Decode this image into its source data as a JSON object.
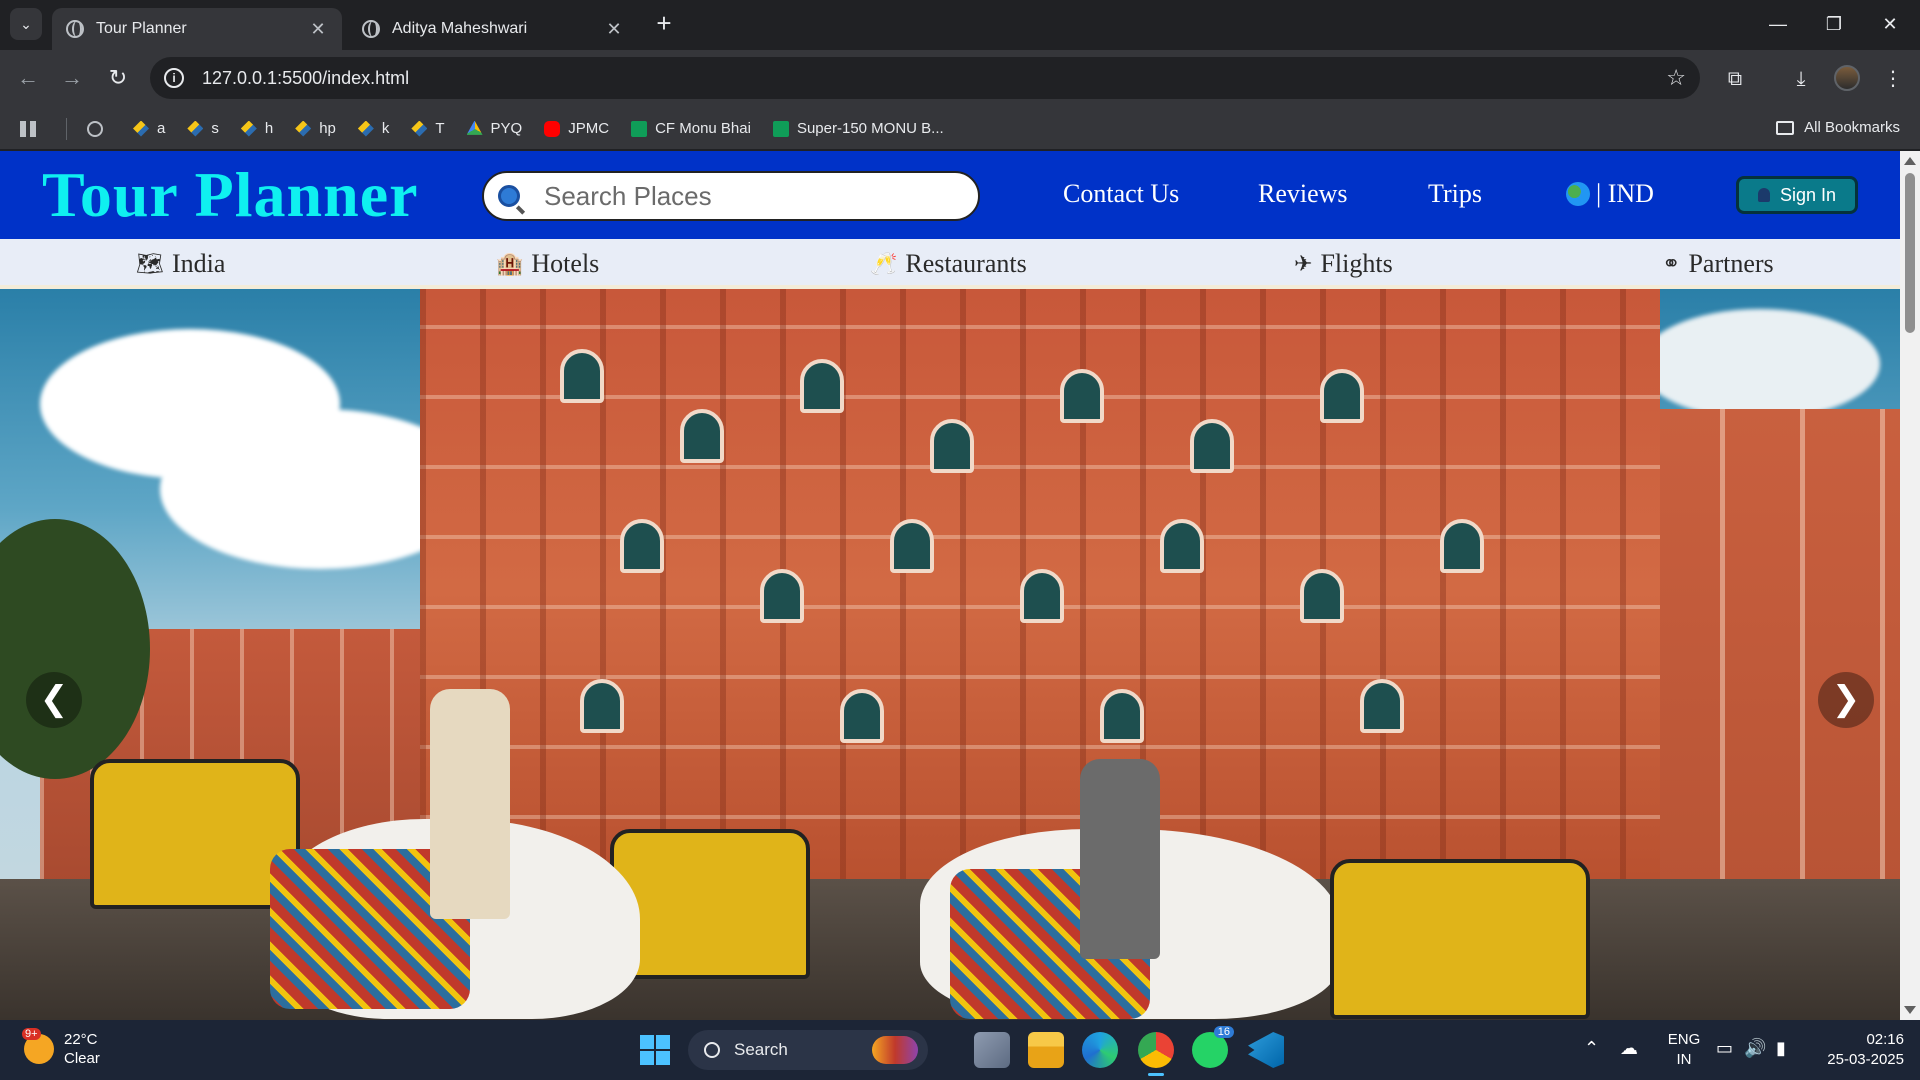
{
  "browser": {
    "tabs": [
      {
        "title": "Tour Planner",
        "active": true
      },
      {
        "title": "Aditya Maheshwari",
        "active": false
      }
    ],
    "url": "127.0.0.1:5500/index.html",
    "bookmarks": [
      {
        "label": "a",
        "icon": "cf-icon"
      },
      {
        "label": "s",
        "icon": "cf-icon"
      },
      {
        "label": "h",
        "icon": "cf-icon"
      },
      {
        "label": "hp",
        "icon": "cf-icon"
      },
      {
        "label": "k",
        "icon": "cf-icon"
      },
      {
        "label": "T",
        "icon": "cf-icon"
      },
      {
        "label": "PYQ",
        "icon": "drive-icon"
      },
      {
        "label": "JPMC",
        "icon": "youtube-icon"
      },
      {
        "label": "CF Monu Bhai",
        "icon": "sheets-icon"
      },
      {
        "label": "Super-150 MONU B...",
        "icon": "sheets-icon"
      }
    ],
    "all_bookmarks": "All Bookmarks"
  },
  "site": {
    "logo": "Tour Planner",
    "search_placeholder": "Search Places",
    "nav": {
      "contact": "Contact Us",
      "reviews": "Reviews",
      "trips": "Trips",
      "region": "| IND"
    },
    "signin": "Sign In",
    "subnav": [
      {
        "label": "India",
        "icon": "🗺"
      },
      {
        "label": "Hotels",
        "icon": "🏨"
      },
      {
        "label": "Restaurants",
        "icon": "🥂"
      },
      {
        "label": "Flights",
        "icon": "✈"
      },
      {
        "label": "Partners",
        "icon": "⚭"
      }
    ],
    "carousel": {
      "prev": "❮",
      "next": "❯"
    }
  },
  "taskbar": {
    "weather_temp": "22°C",
    "weather_desc": "Clear",
    "weather_badge": "9+",
    "search_label": "Search",
    "whatsapp_badge": "16",
    "lang_top": "ENG",
    "lang_bottom": "IN",
    "time": "02:16",
    "date": "25-03-2025"
  }
}
